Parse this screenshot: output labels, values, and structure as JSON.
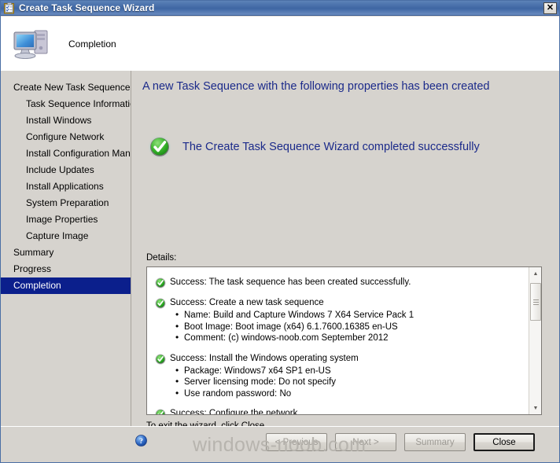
{
  "window": {
    "title": "Create Task Sequence Wizard",
    "title_icon": "task-sequence-clipboard-icon",
    "close_label": "✕"
  },
  "header": {
    "icon": "computer-monitor-icon",
    "title": "Completion"
  },
  "sidebar": {
    "items": [
      {
        "label": "Create New Task Sequence",
        "level": 0,
        "selected": false
      },
      {
        "label": "Task Sequence Information",
        "level": 1,
        "selected": false
      },
      {
        "label": "Install Windows",
        "level": 1,
        "selected": false
      },
      {
        "label": "Configure Network",
        "level": 1,
        "selected": false
      },
      {
        "label": "Install Configuration Manag",
        "level": 1,
        "selected": false
      },
      {
        "label": "Include Updates",
        "level": 1,
        "selected": false
      },
      {
        "label": "Install Applications",
        "level": 1,
        "selected": false
      },
      {
        "label": "System Preparation",
        "level": 1,
        "selected": false
      },
      {
        "label": "Image Properties",
        "level": 1,
        "selected": false
      },
      {
        "label": "Capture Image",
        "level": 1,
        "selected": false
      },
      {
        "label": "Summary",
        "level": 0,
        "selected": false
      },
      {
        "label": "Progress",
        "level": 0,
        "selected": false
      },
      {
        "label": "Completion",
        "level": 0,
        "selected": true
      }
    ],
    "scroll_left_icon": "◄",
    "scroll_right_icon": "►"
  },
  "main": {
    "heading": "A new Task Sequence with the following properties has been created",
    "result_icon": "success-check-icon",
    "result_text": "The Create Task Sequence Wizard completed successfully",
    "details_label": "Details:",
    "exit_note": "To exit the wizard, click Close.",
    "details": [
      {
        "icon": "success-check-icon",
        "heading": "Success: The task sequence has been created successfully.",
        "bullets": []
      },
      {
        "icon": "success-check-icon",
        "heading": "Success: Create a new task sequence",
        "bullets": [
          "Name: Build and Capture Windows 7 X64 Service Pack 1",
          "Boot Image: Boot image (x64) 6.1.7600.16385 en-US",
          "Comment: (c) windows-noob.com September 2012"
        ]
      },
      {
        "icon": "success-check-icon",
        "heading": "Success: Install the Windows operating system",
        "bullets": [
          "Package: Windows7 x64 SP1 en-US",
          "Server licensing mode: Do not specify",
          "Use random password: No"
        ]
      },
      {
        "icon": "success-check-icon",
        "heading": "Success: Configure the network",
        "bullets": []
      }
    ],
    "scroll_up_icon": "▲",
    "scroll_down_icon": "▼"
  },
  "footer": {
    "help_icon": "help-question-icon",
    "buttons": [
      {
        "label": "< Previous",
        "enabled": false,
        "default": false
      },
      {
        "label": "Next >",
        "enabled": false,
        "default": false
      },
      {
        "label": "Summary",
        "enabled": false,
        "default": false
      },
      {
        "label": "Close",
        "enabled": true,
        "default": true
      }
    ]
  },
  "watermark": "windows-noob.com",
  "colors": {
    "title_bar": "#436aa6",
    "heading_blue": "#1b2a8a",
    "selection_navy": "#0b1f8c",
    "success_green": "#2ea82e",
    "dialog_face": "#d6d3ce"
  }
}
